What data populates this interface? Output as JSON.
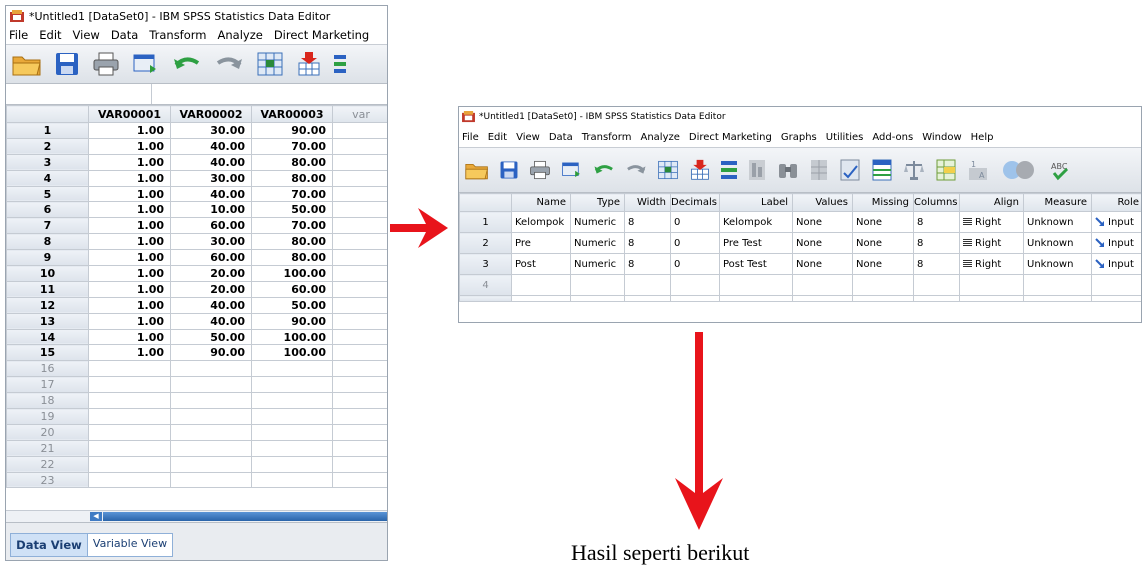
{
  "left_window": {
    "title": "*Untitled1 [DataSet0] - IBM SPSS Statistics Data Editor",
    "menu": [
      "File",
      "Edit",
      "View",
      "Data",
      "Transform",
      "Analyze",
      "Direct Marketing"
    ],
    "columns": [
      "VAR00001",
      "VAR00002",
      "VAR00003",
      "var"
    ],
    "rows": [
      [
        "1",
        "1.00",
        "30.00",
        "90.00"
      ],
      [
        "2",
        "1.00",
        "40.00",
        "70.00"
      ],
      [
        "3",
        "1.00",
        "40.00",
        "80.00"
      ],
      [
        "4",
        "1.00",
        "30.00",
        "80.00"
      ],
      [
        "5",
        "1.00",
        "40.00",
        "70.00"
      ],
      [
        "6",
        "1.00",
        "10.00",
        "50.00"
      ],
      [
        "7",
        "1.00",
        "60.00",
        "70.00"
      ],
      [
        "8",
        "1.00",
        "30.00",
        "80.00"
      ],
      [
        "9",
        "1.00",
        "60.00",
        "80.00"
      ],
      [
        "10",
        "1.00",
        "20.00",
        "100.00"
      ],
      [
        "11",
        "1.00",
        "20.00",
        "60.00"
      ],
      [
        "12",
        "1.00",
        "40.00",
        "50.00"
      ],
      [
        "13",
        "1.00",
        "40.00",
        "90.00"
      ],
      [
        "14",
        "1.00",
        "50.00",
        "100.00"
      ],
      [
        "15",
        "1.00",
        "90.00",
        "100.00"
      ],
      [
        "16",
        "",
        "",
        ""
      ],
      [
        "17",
        "",
        "",
        ""
      ],
      [
        "18",
        "",
        "",
        ""
      ],
      [
        "19",
        "",
        "",
        ""
      ],
      [
        "20",
        "",
        "",
        ""
      ],
      [
        "21",
        "",
        "",
        ""
      ],
      [
        "22",
        "",
        "",
        ""
      ],
      [
        "23",
        "",
        "",
        ""
      ]
    ],
    "tabs": [
      "Data View",
      "Variable View"
    ],
    "active_tab": "Data View"
  },
  "right_window": {
    "title": "*Untitled1 [DataSet0] - IBM SPSS Statistics Data Editor",
    "menu": [
      "File",
      "Edit",
      "View",
      "Data",
      "Transform",
      "Analyze",
      "Direct Marketing",
      "Graphs",
      "Utilities",
      "Add-ons",
      "Window",
      "Help"
    ],
    "columns": [
      "Name",
      "Type",
      "Width",
      "Decimals",
      "Label",
      "Values",
      "Missing",
      "Columns",
      "Align",
      "Measure",
      "Role"
    ],
    "rows": [
      [
        "1",
        "Kelompok",
        "Numeric",
        "8",
        "0",
        "Kelompok",
        "None",
        "None",
        "8",
        "Right",
        "Unknown",
        "Input"
      ],
      [
        "2",
        "Pre",
        "Numeric",
        "8",
        "0",
        "Pre Test",
        "None",
        "None",
        "8",
        "Right",
        "Unknown",
        "Input"
      ],
      [
        "3",
        "Post",
        "Numeric",
        "8",
        "0",
        "Post Test",
        "None",
        "None",
        "8",
        "Right",
        "Unknown",
        "Input"
      ],
      [
        "4",
        "",
        "",
        "",
        "",
        "",
        "",
        "",
        "",
        "",
        "",
        ""
      ]
    ]
  },
  "caption": "Hasil seperti berikut",
  "colors": {
    "arrow": "#e8141b",
    "active_tab": "#cfe1f6",
    "selection": "#2b6cb3"
  }
}
